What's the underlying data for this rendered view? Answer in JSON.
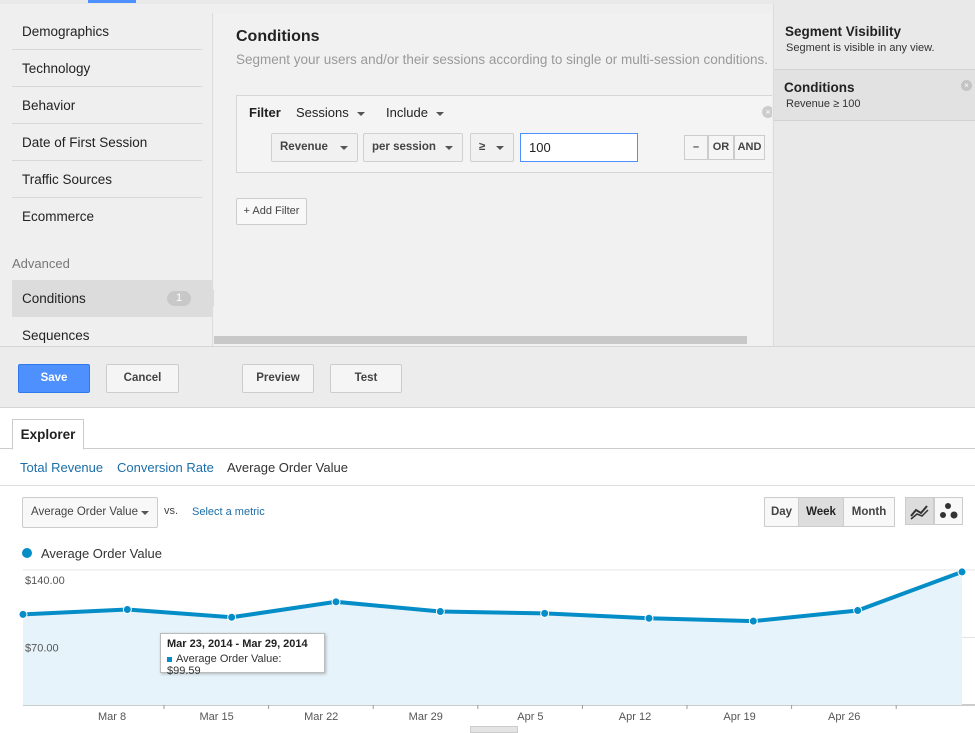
{
  "leftnav": {
    "items": [
      "Demographics",
      "Technology",
      "Behavior",
      "Date of First Session",
      "Traffic Sources",
      "Ecommerce"
    ],
    "advanced_heading": "Advanced",
    "conditions_label": "Conditions",
    "conditions_count": "1",
    "sequences_label": "Sequences"
  },
  "editor": {
    "title": "Conditions",
    "subtitle": "Segment your users and/or their sessions according to single or multi-session conditions.",
    "filter_label": "Filter",
    "scope": "Sessions",
    "mode": "Include",
    "dimension": "Revenue",
    "per": "per session",
    "operator": "≥",
    "value": "100",
    "btn_minus": "–",
    "btn_or": "OR",
    "btn_and": "AND",
    "add_filter": "+ Add Filter"
  },
  "summary": {
    "visibility_title": "Segment Visibility",
    "visibility_sub": "Segment is visible in any view.",
    "conditions_title": "Conditions",
    "conditions_sub": "Revenue ≥ 100"
  },
  "actions": {
    "save": "Save",
    "cancel": "Cancel",
    "preview": "Preview",
    "test": "Test"
  },
  "explorer": {
    "tab": "Explorer",
    "metric_links": [
      "Total Revenue",
      "Conversion Rate",
      "Average Order Value"
    ],
    "metric_select": "Average Order Value",
    "vs": "vs.",
    "select_metric": "Select a metric",
    "granularity": [
      "Day",
      "Week",
      "Month"
    ],
    "active_granularity": "Week",
    "legend": "Average Order Value",
    "tooltip_date": "Mar 23, 2014 - Mar 29, 2014",
    "tooltip_value": "Average Order Value: $99.59"
  },
  "colors": {
    "accent": "#4d90fe",
    "series": "#058dc7",
    "area": "#e6f3fa"
  },
  "chart_data": {
    "type": "area",
    "series": [
      {
        "name": "Average Order Value",
        "values": [
          94,
          99,
          91,
          107,
          97,
          95,
          90,
          87,
          98,
          138
        ]
      }
    ],
    "y_ticks": [
      "$70.00",
      "$140.00"
    ],
    "ylim": [
      0,
      140
    ],
    "x_labels": [
      "Mar 8",
      "Mar 15",
      "Mar 22",
      "Mar 29",
      "Apr 5",
      "Apr 12",
      "Apr 19",
      "Apr 26"
    ]
  }
}
